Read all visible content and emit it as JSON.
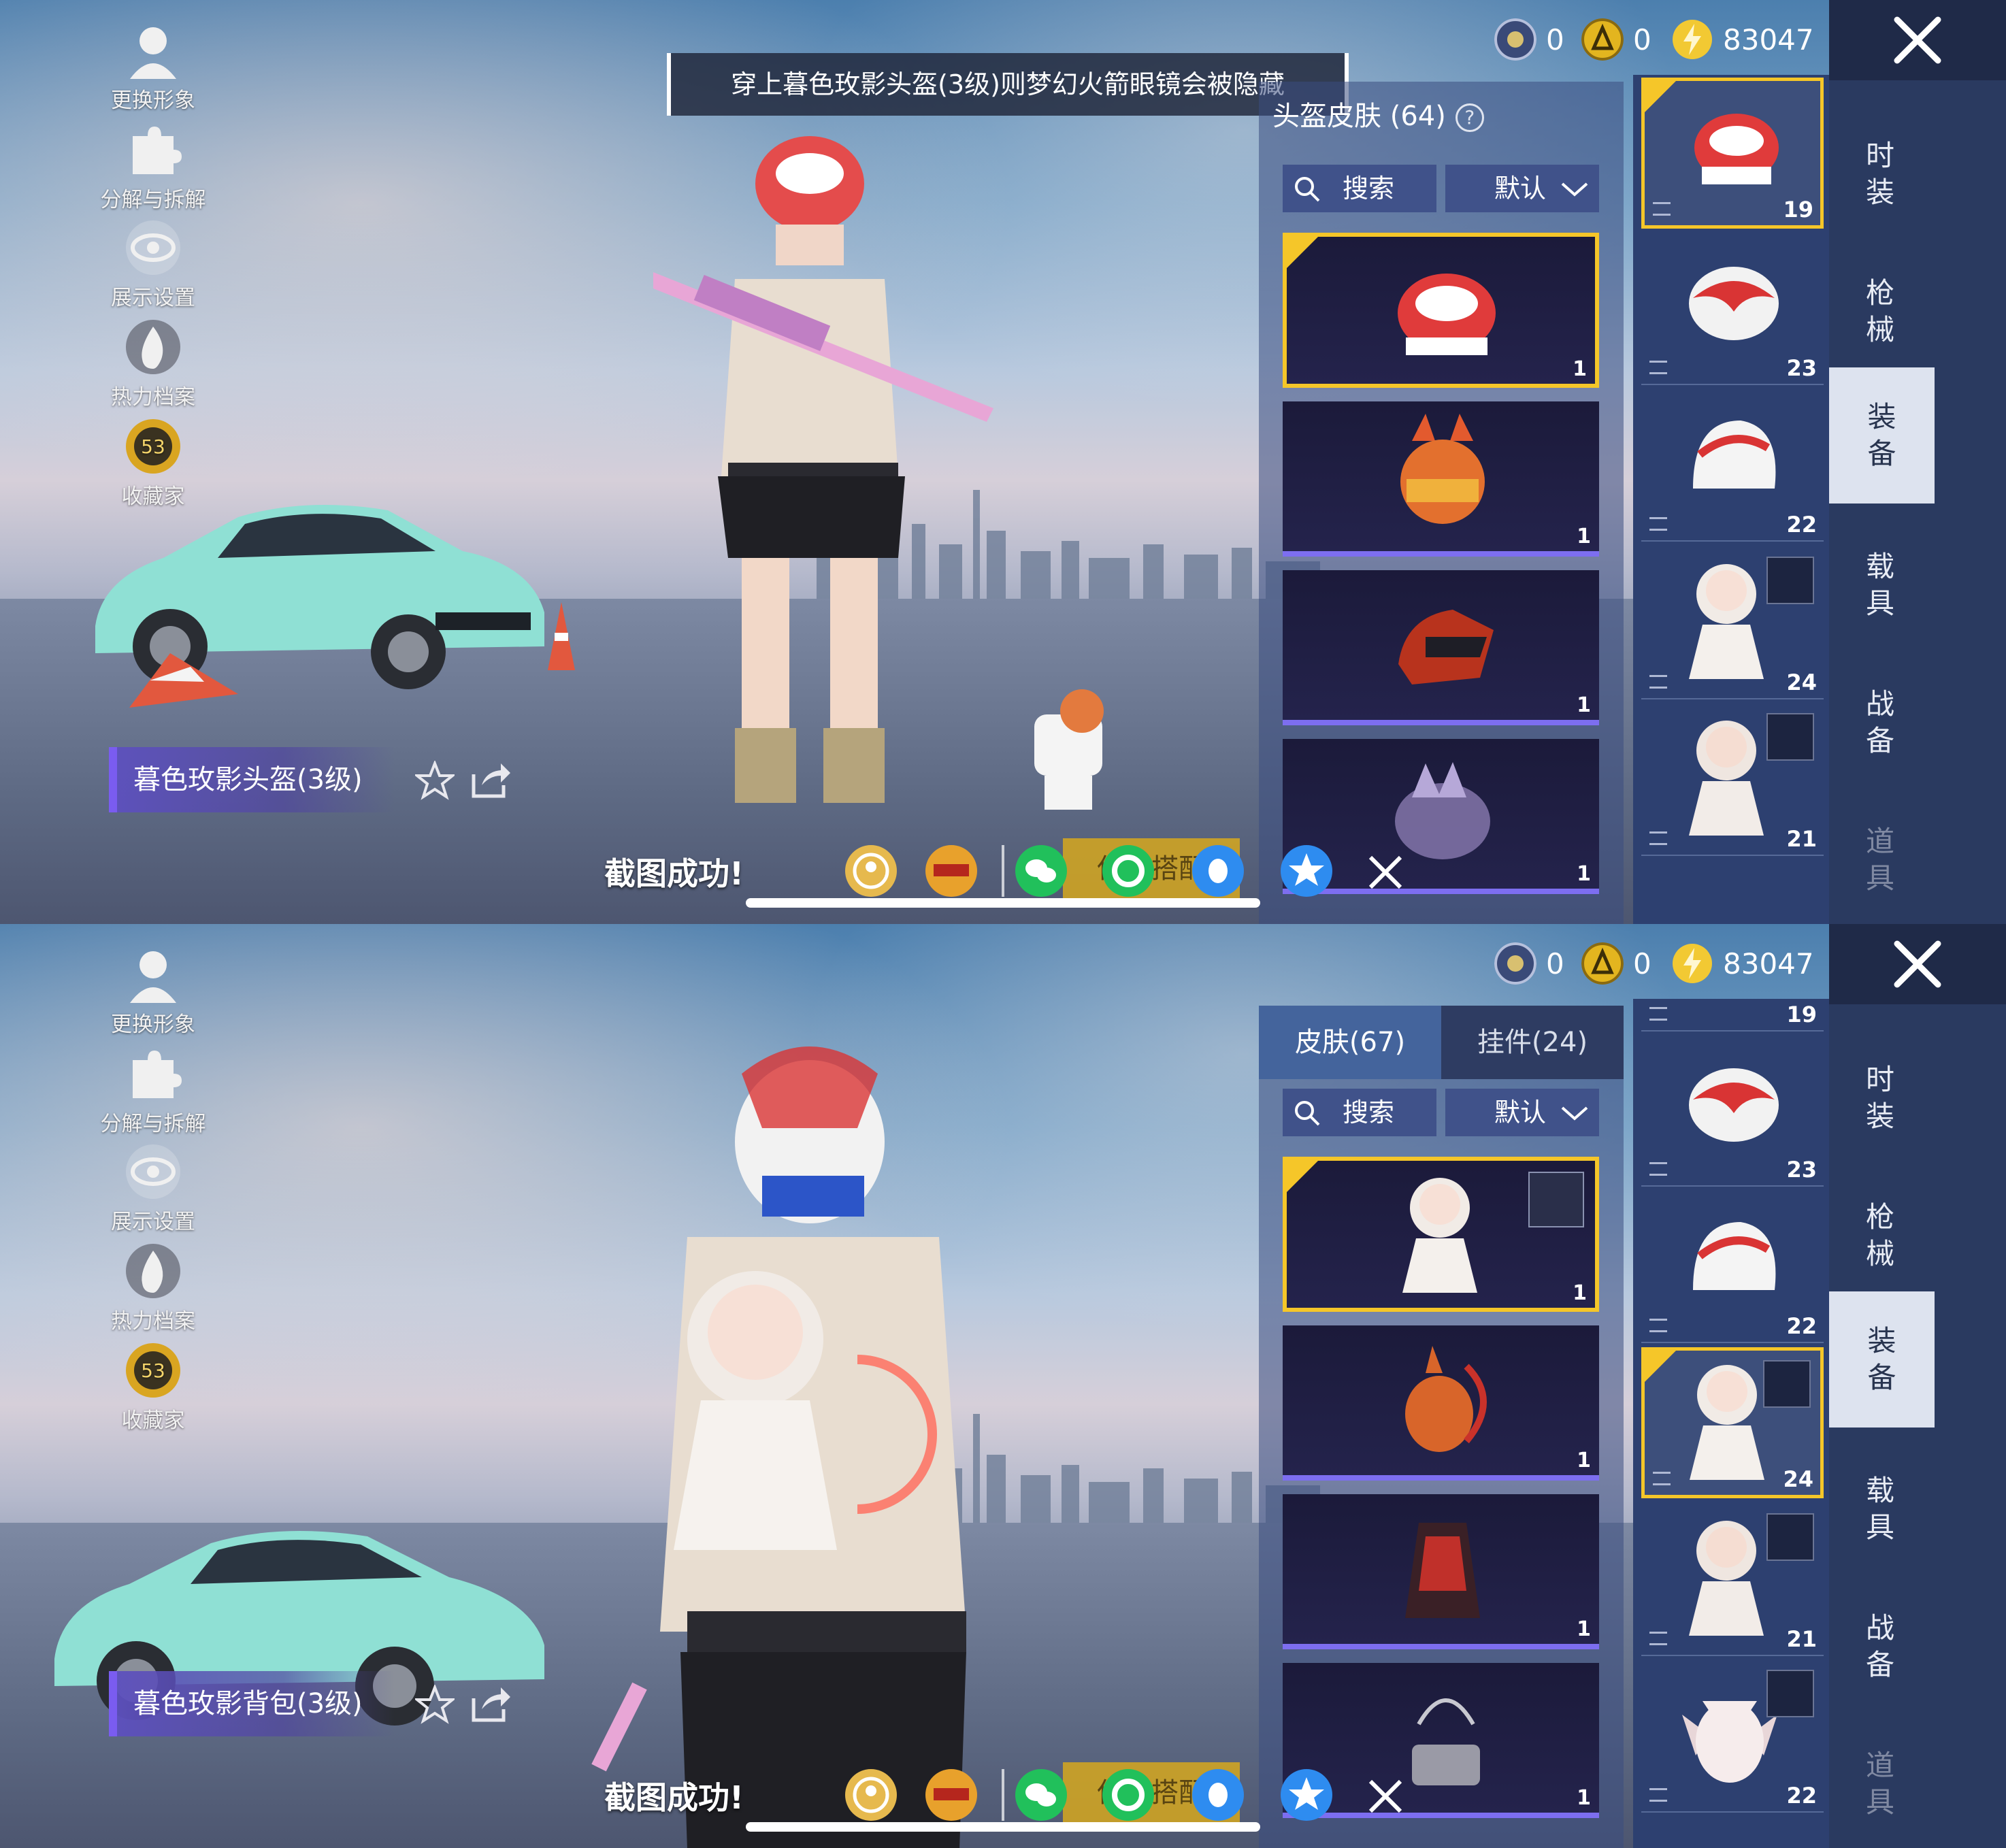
{
  "colors": {
    "accent_gold": "#f5c629",
    "rarity_purple": "#7d6ef0",
    "nav_bg": "#2a3a60",
    "panel_bg": "#2d4070"
  },
  "side_menu": [
    {
      "label": "更换形象",
      "icon": "person-icon"
    },
    {
      "label": "分解与拆解",
      "icon": "puzzle-icon"
    },
    {
      "label": "展示设置",
      "icon": "eye-icon"
    },
    {
      "label": "热力档案",
      "icon": "flame-icon"
    },
    {
      "label": "收藏家",
      "icon": "collector-badge-icon",
      "badge": "53"
    }
  ],
  "currency": [
    {
      "icon": "ticket-coin-icon",
      "value": "0"
    },
    {
      "icon": "gold-coin-icon",
      "value": "0"
    },
    {
      "icon": "lightning-coin-icon",
      "value": "83047"
    }
  ],
  "categories": [
    {
      "label": "时\n装",
      "state": "normal"
    },
    {
      "label": "枪\n械",
      "state": "normal"
    },
    {
      "label": "装\n备",
      "state": "active"
    },
    {
      "label": "载\n具",
      "state": "normal"
    },
    {
      "label": "战\n备",
      "state": "normal"
    },
    {
      "label": "道\n具",
      "state": "faded"
    }
  ],
  "share_bar": {
    "toast": "截图成功!",
    "save_label": "保存搭配",
    "icons": [
      "game-center-icon",
      "peace-elite-icon",
      "wechat-icon",
      "moments-icon",
      "qq-icon",
      "qzone-icon"
    ]
  },
  "panels": {
    "top": {
      "tip": "穿上暮色玫影头盔(3级)则梦幻火箭眼镜会被隐藏",
      "item_name": "暮色玫影头盔(3级)",
      "list_title": "头盔皮肤 (64)",
      "search_label": "搜索",
      "sort_label": "默认",
      "cards": [
        {
          "item": "rose-helmet",
          "count": "1",
          "selected": true
        },
        {
          "item": "fox-helmet",
          "count": "1",
          "selected": false
        },
        {
          "item": "dragon-helmet",
          "count": "1",
          "selected": false
        },
        {
          "item": "crystal-helmet",
          "count": "1",
          "selected": false
        }
      ],
      "slots": [
        {
          "item": "rose-helmet",
          "count": "19",
          "selected": true
        },
        {
          "item": "rose-helmet-2",
          "count": "23",
          "selected": false
        },
        {
          "item": "white-helmet",
          "count": "22",
          "selected": false
        },
        {
          "item": "doll-backpack",
          "count": "24",
          "selected": false,
          "tag": true
        },
        {
          "item": "doll-backpack-2",
          "count": "21",
          "selected": false,
          "tag": true
        }
      ]
    },
    "bottom": {
      "item_name": "暮色玫影背包(3级)",
      "tabs": [
        {
          "label": "皮肤(67)"
        },
        {
          "label": "挂件(24)"
        }
      ],
      "search_label": "搜索",
      "sort_label": "默认",
      "cards": [
        {
          "item": "doll-backpack",
          "count": "1",
          "selected": true,
          "tag": true
        },
        {
          "item": "kangaroo-backpack",
          "count": "1",
          "selected": false
        },
        {
          "item": "red-armor-backpack",
          "count": "1",
          "selected": false
        },
        {
          "item": "silver-pouch-backpack",
          "count": "1",
          "selected": false
        }
      ],
      "slots": [
        {
          "item": "partial",
          "count": "19",
          "selected": false
        },
        {
          "item": "rose-helmet-2",
          "count": "23",
          "selected": false
        },
        {
          "item": "white-helmet",
          "count": "22",
          "selected": false
        },
        {
          "item": "doll-backpack",
          "count": "24",
          "selected": true,
          "tag": true
        },
        {
          "item": "doll-backpack-2",
          "count": "21",
          "selected": false,
          "tag": true
        },
        {
          "item": "bat-backpack",
          "count": "22",
          "selected": false,
          "tag": true
        }
      ]
    }
  }
}
